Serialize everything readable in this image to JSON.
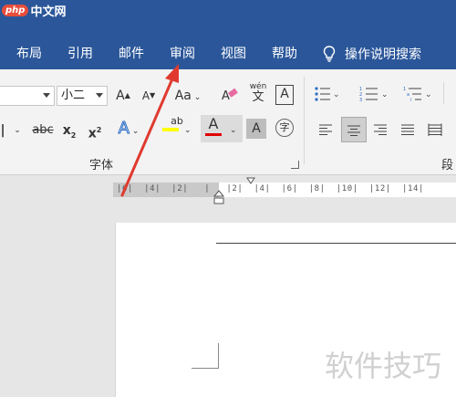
{
  "logo": {
    "badge": "php",
    "text": "中文网"
  },
  "tabs": [
    {
      "label": "布局"
    },
    {
      "label": "引用"
    },
    {
      "label": "邮件"
    },
    {
      "label": "审阅"
    },
    {
      "label": "视图"
    },
    {
      "label": "帮助"
    }
  ],
  "tellme": {
    "label": "操作说明搜索"
  },
  "font": {
    "name_value": "",
    "size_value": "小二",
    "grow_label": "A",
    "shrink_label": "A",
    "case_label": "Aa",
    "phonetic_top": "wén",
    "phonetic_bottom": "文",
    "border_label": "A",
    "strike_label": "abc",
    "sub_label": "x",
    "sub_small": "2",
    "sup_label": "x",
    "sup_small": "2",
    "effects_label": "A",
    "highlight_label": "ab",
    "color_label": "A",
    "shading_label": "A",
    "enclose_label": "字",
    "group_label": "字体"
  },
  "paragraph": {
    "group_label_partial": "段"
  },
  "ruler": {
    "text": "|6|  |4|  |2|   |   |2|  |4|  |6|  |8|  |10|  |12|  |14|"
  },
  "watermark": "软件技巧",
  "colors": {
    "ribbon_blue": "#2b579a",
    "annotation_arrow": "#e03a2f",
    "highlight_yellow": "#ffff00",
    "font_color_red": "#e00000"
  }
}
